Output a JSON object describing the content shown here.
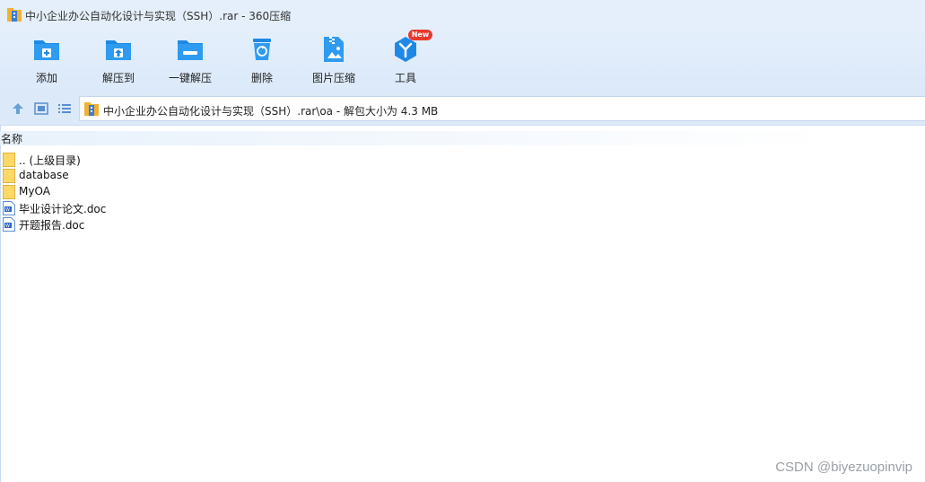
{
  "window": {
    "title": "中小企业办公自动化设计与实现（SSH）.rar - 360压缩"
  },
  "toolbar": {
    "items": [
      {
        "label": "添加",
        "icon": "add-folder-icon"
      },
      {
        "label": "解压到",
        "icon": "extract-to-icon"
      },
      {
        "label": "一键解压",
        "icon": "one-click-extract-icon"
      },
      {
        "label": "删除",
        "icon": "recycle-bin-icon"
      },
      {
        "label": "图片压缩",
        "icon": "image-zip-icon"
      },
      {
        "label": "工具",
        "icon": "tools-icon",
        "badge": "New"
      }
    ]
  },
  "address": {
    "path": "中小企业办公自动化设计与实现（SSH）.rar\\oa - 解包大小为 4.3 MB"
  },
  "list": {
    "column_name": "名称",
    "items": [
      {
        "name": ".. (上级目录)",
        "type": "folder"
      },
      {
        "name": "database",
        "type": "folder"
      },
      {
        "name": "MyOA",
        "type": "folder"
      },
      {
        "name": "毕业设计论文.doc",
        "type": "doc"
      },
      {
        "name": "开题报告.doc",
        "type": "doc"
      }
    ]
  },
  "watermark": "CSDN @biyezuopinvip",
  "colors": {
    "accent": "#1e88e5",
    "titlebar": "#e4effb",
    "folder": "#fcd869",
    "badge": "#e8382e"
  }
}
